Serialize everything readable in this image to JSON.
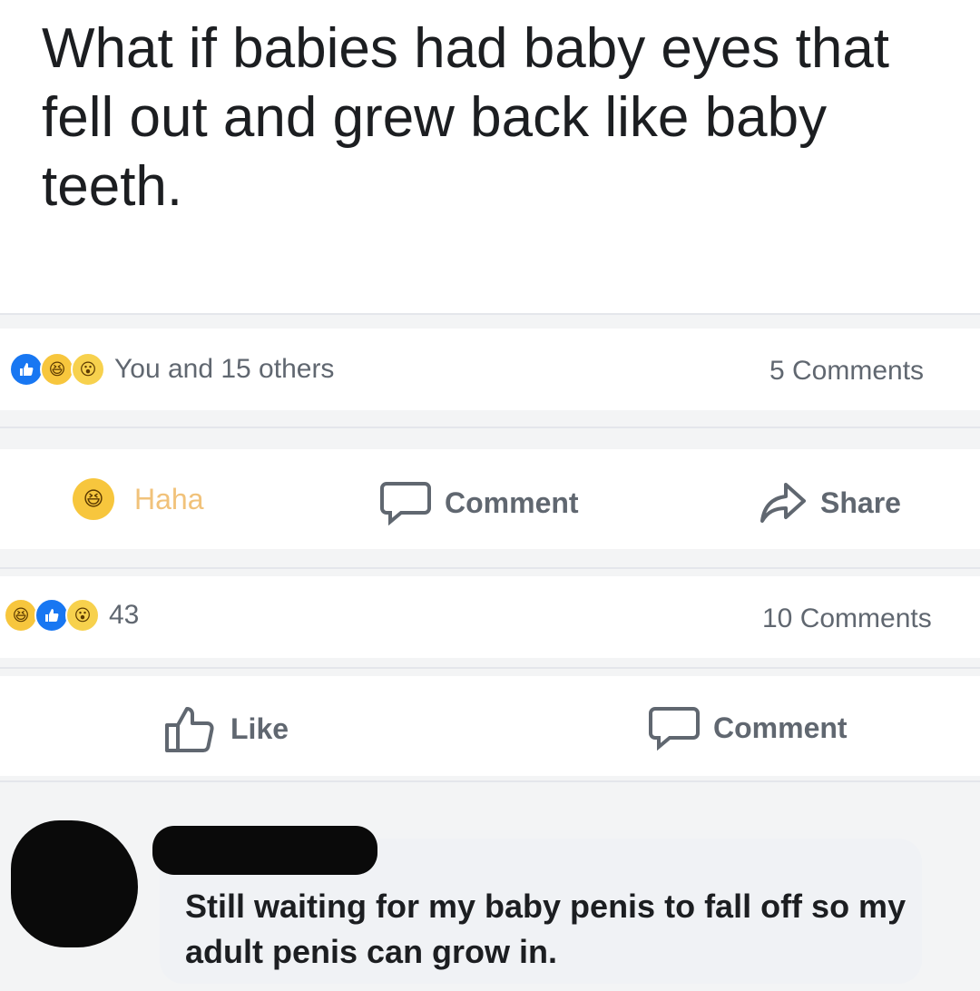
{
  "post": {
    "text": "What if babies had baby eyes that fell out and grew back like baby teeth."
  },
  "post_stats": {
    "reaction_icons": [
      "like-icon",
      "haha-icon",
      "wow-icon"
    ],
    "reaction_count": "You and 15 others",
    "comments_count": "5 Comments"
  },
  "post_actions": {
    "reaction_label": "Haha",
    "comment_label": "Comment",
    "share_label": "Share"
  },
  "second_stats": {
    "reaction_icons": [
      "haha-icon",
      "like-icon",
      "wow-icon"
    ],
    "reaction_count": "43",
    "comments_count": "10 Comments"
  },
  "second_actions": {
    "like_label": "Like",
    "comment_label": "Comment"
  },
  "comment": {
    "author": "",
    "text": "Still waiting for my baby penis to fall off so my adult penis can grow in."
  },
  "colors": {
    "text": "#1c1e21",
    "muted": "#606770",
    "like_blue": "#1877f2",
    "haha_yellow": "#f7c63d",
    "background": "#f3f4f5"
  }
}
